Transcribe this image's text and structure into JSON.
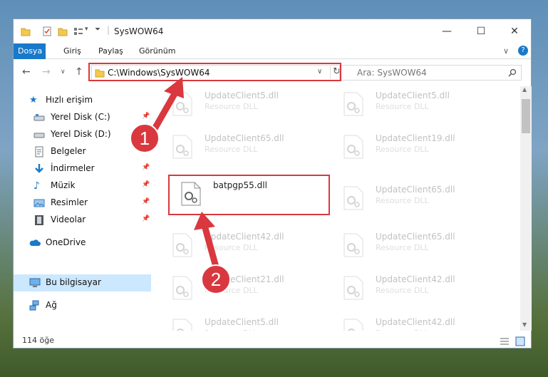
{
  "window": {
    "title": "SysWOW64",
    "controls": {
      "minimize": "—",
      "maximize": "☐",
      "close": "✕"
    }
  },
  "ribbon": {
    "tabs": [
      "Dosya",
      "Giriş",
      "Paylaş",
      "Görünüm"
    ],
    "active_tab": "Dosya"
  },
  "address": {
    "path": "C:\\Windows\\SysWOW64",
    "search_placeholder": "Ara: SysWOW64"
  },
  "sidebar": {
    "quick_access": "Hızlı erişim",
    "items": [
      {
        "label": "Yerel Disk (C:)",
        "pinned": true
      },
      {
        "label": "Yerel Disk (D:)",
        "pinned": true
      },
      {
        "label": "Belgeler",
        "pinned": true
      },
      {
        "label": "İndirmeler",
        "pinned": true
      },
      {
        "label": "Müzik",
        "pinned": true
      },
      {
        "label": "Resimler",
        "pinned": true
      },
      {
        "label": "Videolar",
        "pinned": true
      }
    ],
    "onedrive": "OneDrive",
    "this_pc": "Bu bilgisayar",
    "network": "Ağ"
  },
  "files": {
    "left_column": [
      {
        "name": "UpdateClient5.dll",
        "type": "Resource DLL"
      },
      {
        "name": "UpdateClient65.dll",
        "type": "Resource DLL"
      },
      {
        "name": "batpgp55.dll",
        "type": "",
        "highlighted": true
      },
      {
        "name": "UpdateClient42.dll",
        "type": "Resource DLL"
      },
      {
        "name": "UpdateClient21.dll",
        "type": "Resource DLL"
      },
      {
        "name": "UpdateClient5.dll",
        "type": "Resource DLL"
      }
    ],
    "right_column": [
      {
        "name": "UpdateClient5.dll",
        "type": "Resource DLL"
      },
      {
        "name": "UpdateClient19.dll",
        "type": "Resource DLL"
      },
      {
        "name": "UpdateClient65.dll",
        "type": "Resource DLL"
      },
      {
        "name": "UpdateClient65.dll",
        "type": "Resource DLL"
      },
      {
        "name": "UpdateClient42.dll",
        "type": "Resource DLL"
      },
      {
        "name": "UpdateClient42.dll",
        "type": "Resource DLL"
      }
    ]
  },
  "status": {
    "item_count": "114 öğe"
  },
  "annotations": {
    "step1": "1",
    "step2": "2",
    "color": "#d9383f"
  }
}
